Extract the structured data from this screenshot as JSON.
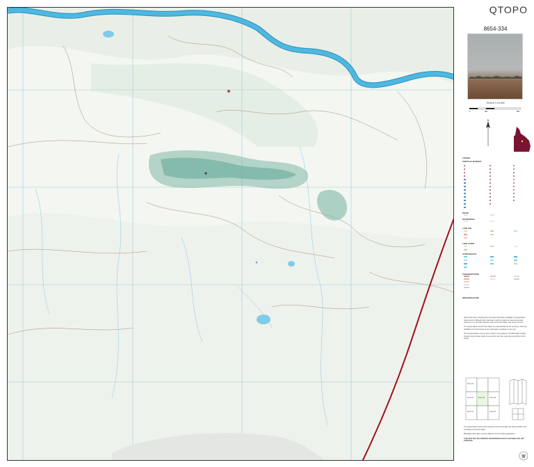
{
  "panel": {
    "brand": "QTOPO",
    "map_number": "8654-334",
    "scale_label": "SCALE 1:10,000",
    "scale_ticks": [
      "0",
      "100",
      "200",
      "300",
      "400",
      "500"
    ],
    "legend_title": "LEGEND",
    "legend_sections": [
      "POINTS OF INTEREST",
      "RELIEF",
      "BOUNDARIES",
      "LAND USE",
      "LAND COVER",
      "HYDROGRAPHY",
      "TRANSPORTATION",
      "INFRASTRUCTURE"
    ],
    "disclaimer": [
      "QTopo has been compiled from the best information available to Queensland Government. Although effort has been made to make the map as accurate reference, it is not field checked, and some information may not be current.",
      "The Queensland Government takes no responsibility for the accuracy, currency, reliability and correctness of any information included on the map.",
      "The representation of any road or track is not evidence of Public Right of Way. People using private roads do so at their own risk; seek the permission of the owner."
    ],
    "footer": [
      "The Queensland Government supports and encourages the dissemination and exchange of its information.",
      "Metadata information can be obtained via the QTopo application.",
      "THIS MAP MAY BE PRINTED OR REPRODUCED BY ANYONE FOR ANY PURPOSE."
    ],
    "index_cells": [
      "8654-331",
      "8654-332",
      "8654-333",
      "8654-334",
      "8654-341",
      "8654-342"
    ]
  },
  "colors": {
    "river": "#4fb8e0",
    "river_edge": "#2a8fc1",
    "ridge": "#7fb8a8",
    "road": "#a0101a",
    "locator_region": "#7a1433",
    "contour": "#a98a74",
    "grid": "#9ccbe0"
  },
  "icons": {
    "compass": "north-arrow-icon",
    "locator": "queensland-locator-icon",
    "logo": "queensland-government-logo-icon"
  }
}
